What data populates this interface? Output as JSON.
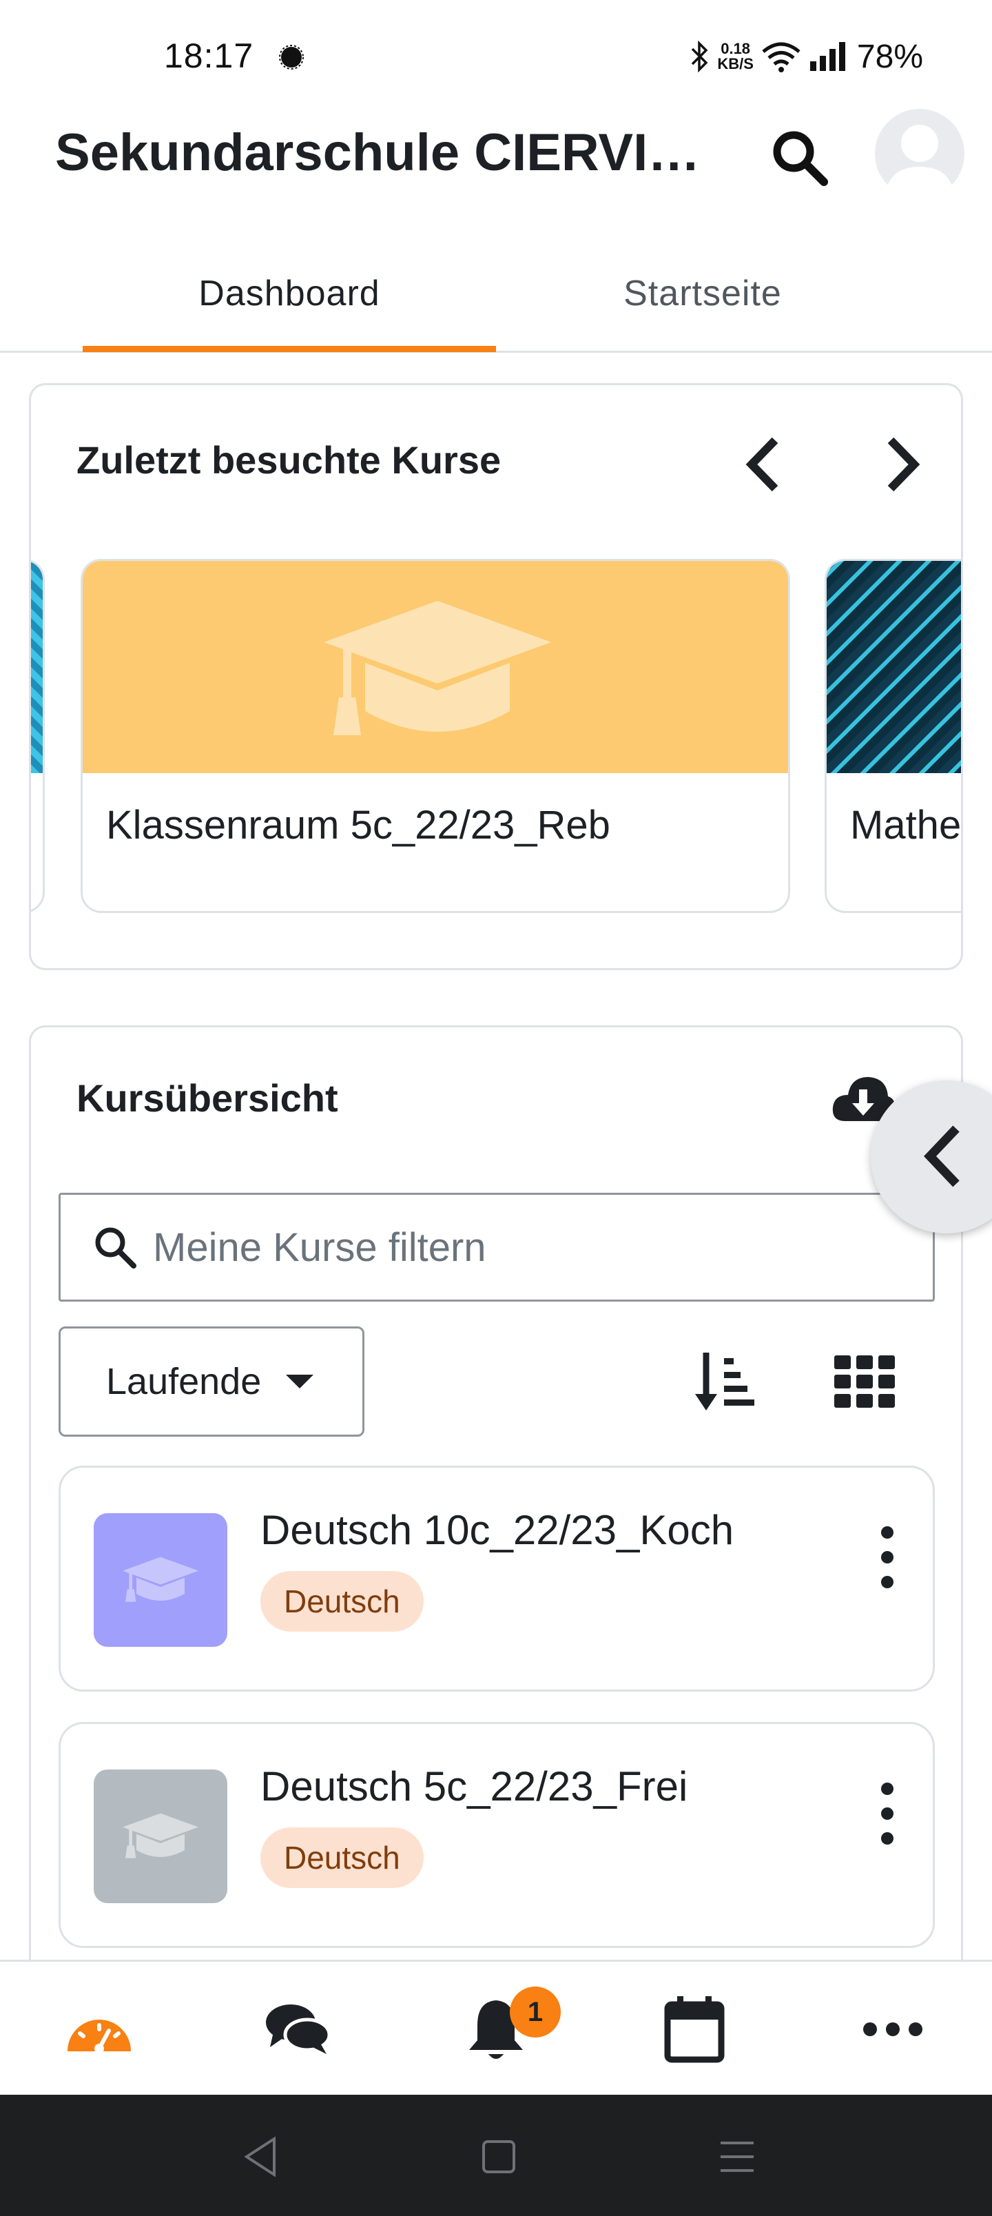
{
  "status_bar": {
    "time": "18:17",
    "net_speed_value": "0.18",
    "net_speed_unit": "KB/S",
    "battery": "78%"
  },
  "header": {
    "title": "Sekundarschule CIERVISTI",
    "search_icon": "search-icon",
    "avatar_icon": "user-avatar-icon"
  },
  "tabs": [
    {
      "label": "Dashboard",
      "active": true
    },
    {
      "label": "Startseite",
      "active": false
    }
  ],
  "recent_courses": {
    "title": "Zuletzt besuchte Kurse",
    "items": [
      {
        "name": "",
        "image": "blue-pattern"
      },
      {
        "name": "Klassenraum 5c_22/23_Reb",
        "image": "graduation-cap",
        "color": "#fdca71"
      },
      {
        "name": "Mathe",
        "image": "blue-pattern"
      }
    ]
  },
  "overview": {
    "title": "Kursübersicht",
    "download_icon": "cloud-download-icon",
    "filter_placeholder": "Meine Kurse filtern",
    "filter_value": "",
    "status_select": "Laufende",
    "sort_icon": "sort-descending-icon",
    "view_icon": "grid-view-icon",
    "courses": [
      {
        "name": "Deutsch 10c_22/23_Koch",
        "category": "Deutsch",
        "color": "#a09ffb"
      },
      {
        "name": "Deutsch 5c_22/23_Frei",
        "category": "Deutsch",
        "color": "#b3bbc1"
      }
    ]
  },
  "bottom_nav": {
    "items": [
      "dashboard-icon",
      "messages-icon",
      "notifications-icon",
      "calendar-icon",
      "more-icon"
    ],
    "notification_count": "1"
  },
  "colors": {
    "accent": "#f98012",
    "text": "#1d2125",
    "border": "#dee2e6"
  }
}
